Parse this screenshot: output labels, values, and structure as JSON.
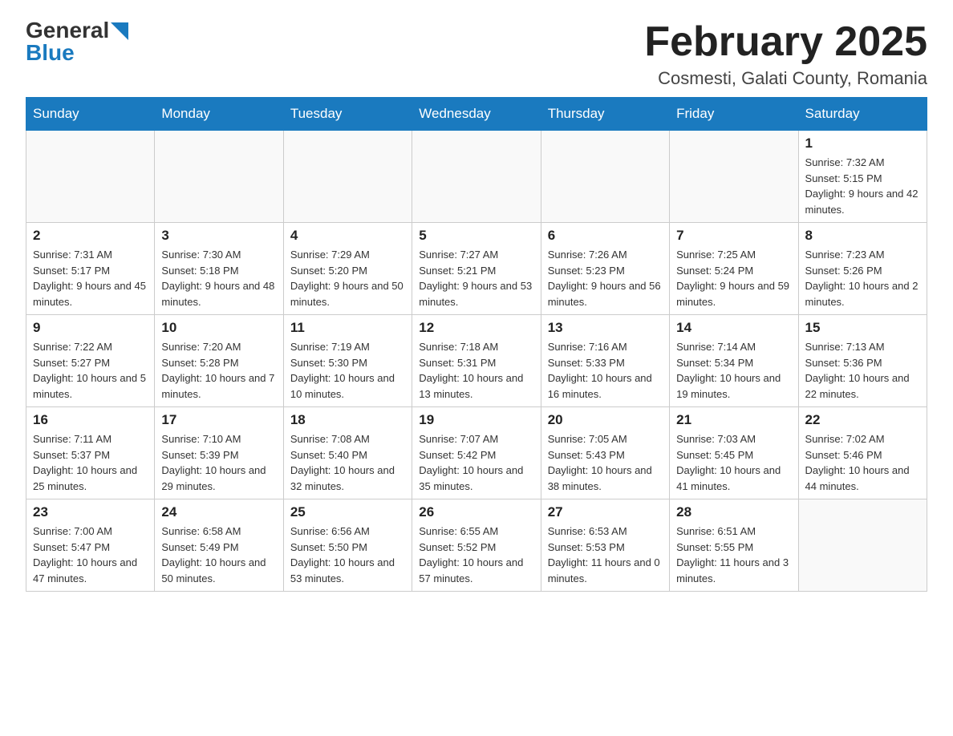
{
  "header": {
    "logo_general": "General",
    "logo_blue": "Blue",
    "month_title": "February 2025",
    "location": "Cosmesti, Galati County, Romania"
  },
  "days_of_week": [
    "Sunday",
    "Monday",
    "Tuesday",
    "Wednesday",
    "Thursday",
    "Friday",
    "Saturday"
  ],
  "weeks": [
    [
      {
        "day": "",
        "info": ""
      },
      {
        "day": "",
        "info": ""
      },
      {
        "day": "",
        "info": ""
      },
      {
        "day": "",
        "info": ""
      },
      {
        "day": "",
        "info": ""
      },
      {
        "day": "",
        "info": ""
      },
      {
        "day": "1",
        "info": "Sunrise: 7:32 AM\nSunset: 5:15 PM\nDaylight: 9 hours and 42 minutes."
      }
    ],
    [
      {
        "day": "2",
        "info": "Sunrise: 7:31 AM\nSunset: 5:17 PM\nDaylight: 9 hours and 45 minutes."
      },
      {
        "day": "3",
        "info": "Sunrise: 7:30 AM\nSunset: 5:18 PM\nDaylight: 9 hours and 48 minutes."
      },
      {
        "day": "4",
        "info": "Sunrise: 7:29 AM\nSunset: 5:20 PM\nDaylight: 9 hours and 50 minutes."
      },
      {
        "day": "5",
        "info": "Sunrise: 7:27 AM\nSunset: 5:21 PM\nDaylight: 9 hours and 53 minutes."
      },
      {
        "day": "6",
        "info": "Sunrise: 7:26 AM\nSunset: 5:23 PM\nDaylight: 9 hours and 56 minutes."
      },
      {
        "day": "7",
        "info": "Sunrise: 7:25 AM\nSunset: 5:24 PM\nDaylight: 9 hours and 59 minutes."
      },
      {
        "day": "8",
        "info": "Sunrise: 7:23 AM\nSunset: 5:26 PM\nDaylight: 10 hours and 2 minutes."
      }
    ],
    [
      {
        "day": "9",
        "info": "Sunrise: 7:22 AM\nSunset: 5:27 PM\nDaylight: 10 hours and 5 minutes."
      },
      {
        "day": "10",
        "info": "Sunrise: 7:20 AM\nSunset: 5:28 PM\nDaylight: 10 hours and 7 minutes."
      },
      {
        "day": "11",
        "info": "Sunrise: 7:19 AM\nSunset: 5:30 PM\nDaylight: 10 hours and 10 minutes."
      },
      {
        "day": "12",
        "info": "Sunrise: 7:18 AM\nSunset: 5:31 PM\nDaylight: 10 hours and 13 minutes."
      },
      {
        "day": "13",
        "info": "Sunrise: 7:16 AM\nSunset: 5:33 PM\nDaylight: 10 hours and 16 minutes."
      },
      {
        "day": "14",
        "info": "Sunrise: 7:14 AM\nSunset: 5:34 PM\nDaylight: 10 hours and 19 minutes."
      },
      {
        "day": "15",
        "info": "Sunrise: 7:13 AM\nSunset: 5:36 PM\nDaylight: 10 hours and 22 minutes."
      }
    ],
    [
      {
        "day": "16",
        "info": "Sunrise: 7:11 AM\nSunset: 5:37 PM\nDaylight: 10 hours and 25 minutes."
      },
      {
        "day": "17",
        "info": "Sunrise: 7:10 AM\nSunset: 5:39 PM\nDaylight: 10 hours and 29 minutes."
      },
      {
        "day": "18",
        "info": "Sunrise: 7:08 AM\nSunset: 5:40 PM\nDaylight: 10 hours and 32 minutes."
      },
      {
        "day": "19",
        "info": "Sunrise: 7:07 AM\nSunset: 5:42 PM\nDaylight: 10 hours and 35 minutes."
      },
      {
        "day": "20",
        "info": "Sunrise: 7:05 AM\nSunset: 5:43 PM\nDaylight: 10 hours and 38 minutes."
      },
      {
        "day": "21",
        "info": "Sunrise: 7:03 AM\nSunset: 5:45 PM\nDaylight: 10 hours and 41 minutes."
      },
      {
        "day": "22",
        "info": "Sunrise: 7:02 AM\nSunset: 5:46 PM\nDaylight: 10 hours and 44 minutes."
      }
    ],
    [
      {
        "day": "23",
        "info": "Sunrise: 7:00 AM\nSunset: 5:47 PM\nDaylight: 10 hours and 47 minutes."
      },
      {
        "day": "24",
        "info": "Sunrise: 6:58 AM\nSunset: 5:49 PM\nDaylight: 10 hours and 50 minutes."
      },
      {
        "day": "25",
        "info": "Sunrise: 6:56 AM\nSunset: 5:50 PM\nDaylight: 10 hours and 53 minutes."
      },
      {
        "day": "26",
        "info": "Sunrise: 6:55 AM\nSunset: 5:52 PM\nDaylight: 10 hours and 57 minutes."
      },
      {
        "day": "27",
        "info": "Sunrise: 6:53 AM\nSunset: 5:53 PM\nDaylight: 11 hours and 0 minutes."
      },
      {
        "day": "28",
        "info": "Sunrise: 6:51 AM\nSunset: 5:55 PM\nDaylight: 11 hours and 3 minutes."
      },
      {
        "day": "",
        "info": ""
      }
    ]
  ]
}
